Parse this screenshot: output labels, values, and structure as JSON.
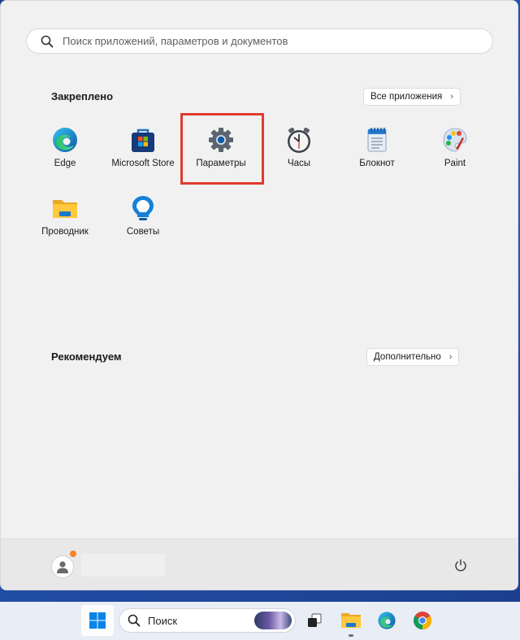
{
  "search": {
    "placeholder": "Поиск приложений, параметров и документов"
  },
  "pinned": {
    "title": "Закреплено",
    "all_apps_label": "Все приложения",
    "apps": [
      {
        "label": "Edge",
        "icon": "edge-icon"
      },
      {
        "label": "Microsoft Store",
        "icon": "store-icon"
      },
      {
        "label": "Параметры",
        "icon": "settings-gear-icon",
        "highlighted": true
      },
      {
        "label": "Часы",
        "icon": "clock-icon"
      },
      {
        "label": "Блокнот",
        "icon": "notepad-icon"
      },
      {
        "label": "Paint",
        "icon": "paint-icon"
      },
      {
        "label": "Проводник",
        "icon": "file-explorer-icon"
      },
      {
        "label": "Советы",
        "icon": "tips-icon"
      }
    ]
  },
  "recommended": {
    "title": "Рекомендуем",
    "more_label": "Дополнительно"
  },
  "taskbar": {
    "search_label": "Поиск",
    "icons": [
      "windows-start-icon",
      "search-icon",
      "task-view-icon",
      "file-explorer-icon",
      "edge-icon",
      "chrome-icon"
    ]
  },
  "colors": {
    "highlight": "#e03b2f",
    "accent": "#0067c0"
  }
}
